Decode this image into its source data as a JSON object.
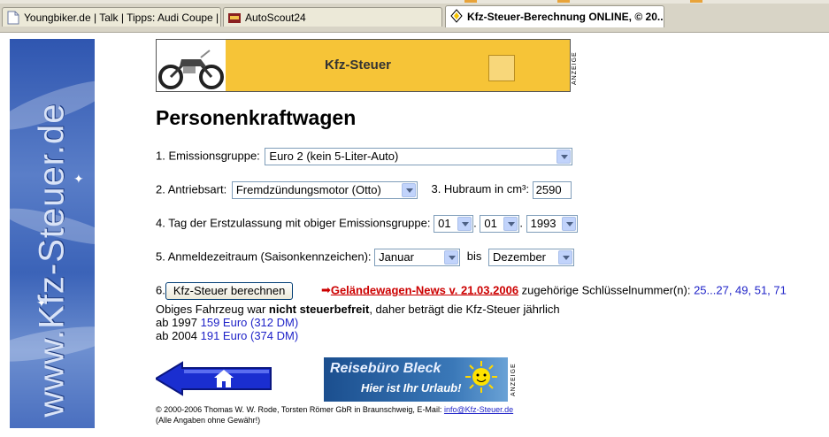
{
  "browser": {
    "tabs": [
      {
        "label": "Youngbiker.de | Talk | Tipps: Audi Coupe | ..."
      },
      {
        "label": "AutoScout24"
      },
      {
        "label": "Kfz-Steuer-Berechnung ONLINE, © 20..."
      }
    ]
  },
  "sidebar": {
    "banner_text": "www.Kfz-Steuer.de"
  },
  "ad_top": {
    "title": "Kfz-Steuer",
    "anzeige": "ANZEIGE"
  },
  "page": {
    "title": "Personenkraftwagen"
  },
  "form": {
    "emission_label": "1. Emissionsgruppe:",
    "emission_value": "Euro 2 (kein 5-Liter-Auto)",
    "drive_label": "2. Antriebsart:",
    "drive_value": "Fremdzündungsmotor (Otto)",
    "displacement_label": "3. Hubraum in cm³:",
    "displacement_value": "2590",
    "date_label": "4. Tag der Erstzulassung mit obiger Emissionsgruppe:",
    "date_day": "01",
    "date_month": "01",
    "date_year": "1993",
    "dot": ".",
    "period_label": "5. Anmeldezeitraum (Saisonkennzeichen):",
    "period_from": "Januar",
    "period_to_label": "bis",
    "period_to": "Dezember",
    "step6_label": "6.",
    "calc_button": "Kfz-Steuer berechnen",
    "news_arrow": "➡",
    "news_link": "Geländewagen-News v. 21.03.2006",
    "key_text": "zugehörige Schlüsselnummer(n):",
    "key_numbers": "25...27, 49, 51, 71"
  },
  "result": {
    "line1_a": "Obiges Fahrzeug war ",
    "line1_bold": "nicht steuerbefreit",
    "line1_b": ", daher beträgt die Kfz-Steuer jährlich",
    "line2_label": "ab 1997",
    "line2_value": "159 Euro (312 DM)",
    "line3_label": "ab 2004",
    "line3_value": "191 Euro (374 DM)"
  },
  "ad_bottom": {
    "title": "Reisebüro Bleck",
    "subtitle": "Hier ist Ihr Urlaub!",
    "anzeige": "ANZEIGE"
  },
  "footer": {
    "copyright": "© 2000-2006 Thomas W. W. Rode, Torsten Römer GbR in Braunschweig, E-Mail:",
    "email": "info@Kfz-Steuer.de",
    "disclaimer": "(Alle Angaben ohne Gewähr!)"
  },
  "colors": {
    "accent_red": "#cc0000",
    "link_blue": "#1f23c8",
    "ad_yellow": "#f6c437"
  }
}
